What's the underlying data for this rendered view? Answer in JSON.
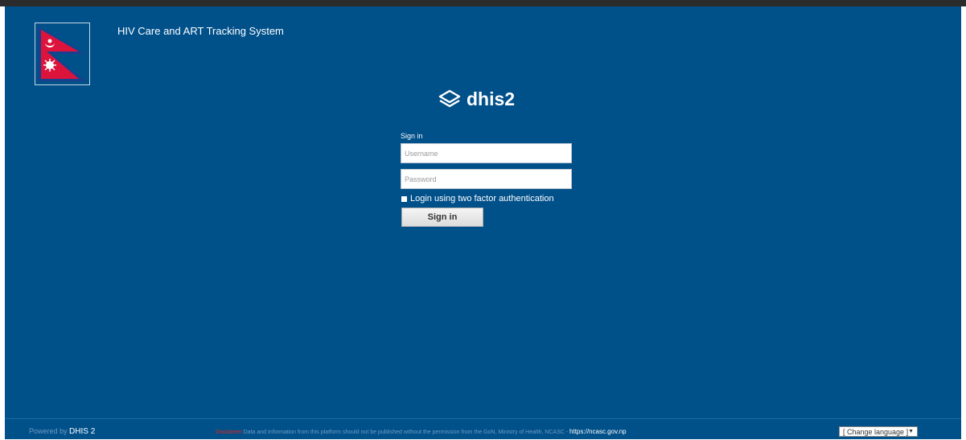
{
  "app_title": "HIV Care and ART Tracking System",
  "logo": {
    "text": "dhis2",
    "icon": "dhis2-logo-icon"
  },
  "signin": {
    "heading": "Sign in",
    "username_placeholder": "Username",
    "password_placeholder": "Password",
    "twofa_label": "Login using two factor authentication",
    "button_label": "Sign in"
  },
  "footer": {
    "powered_prefix": "Powered by",
    "powered_brand": "DHIS 2",
    "disclaimer_label": "Disclaimer:",
    "disclaimer_text": "Data and Information from this platform should not be published without the permission from the GoN, Ministry of Health, NCASC - ",
    "disclaimer_link": "https://ncasc.gov.np",
    "language_select": "[ Change language ]"
  },
  "colors": {
    "background": "#00508a",
    "disclaimer_label": "#e0281c"
  }
}
